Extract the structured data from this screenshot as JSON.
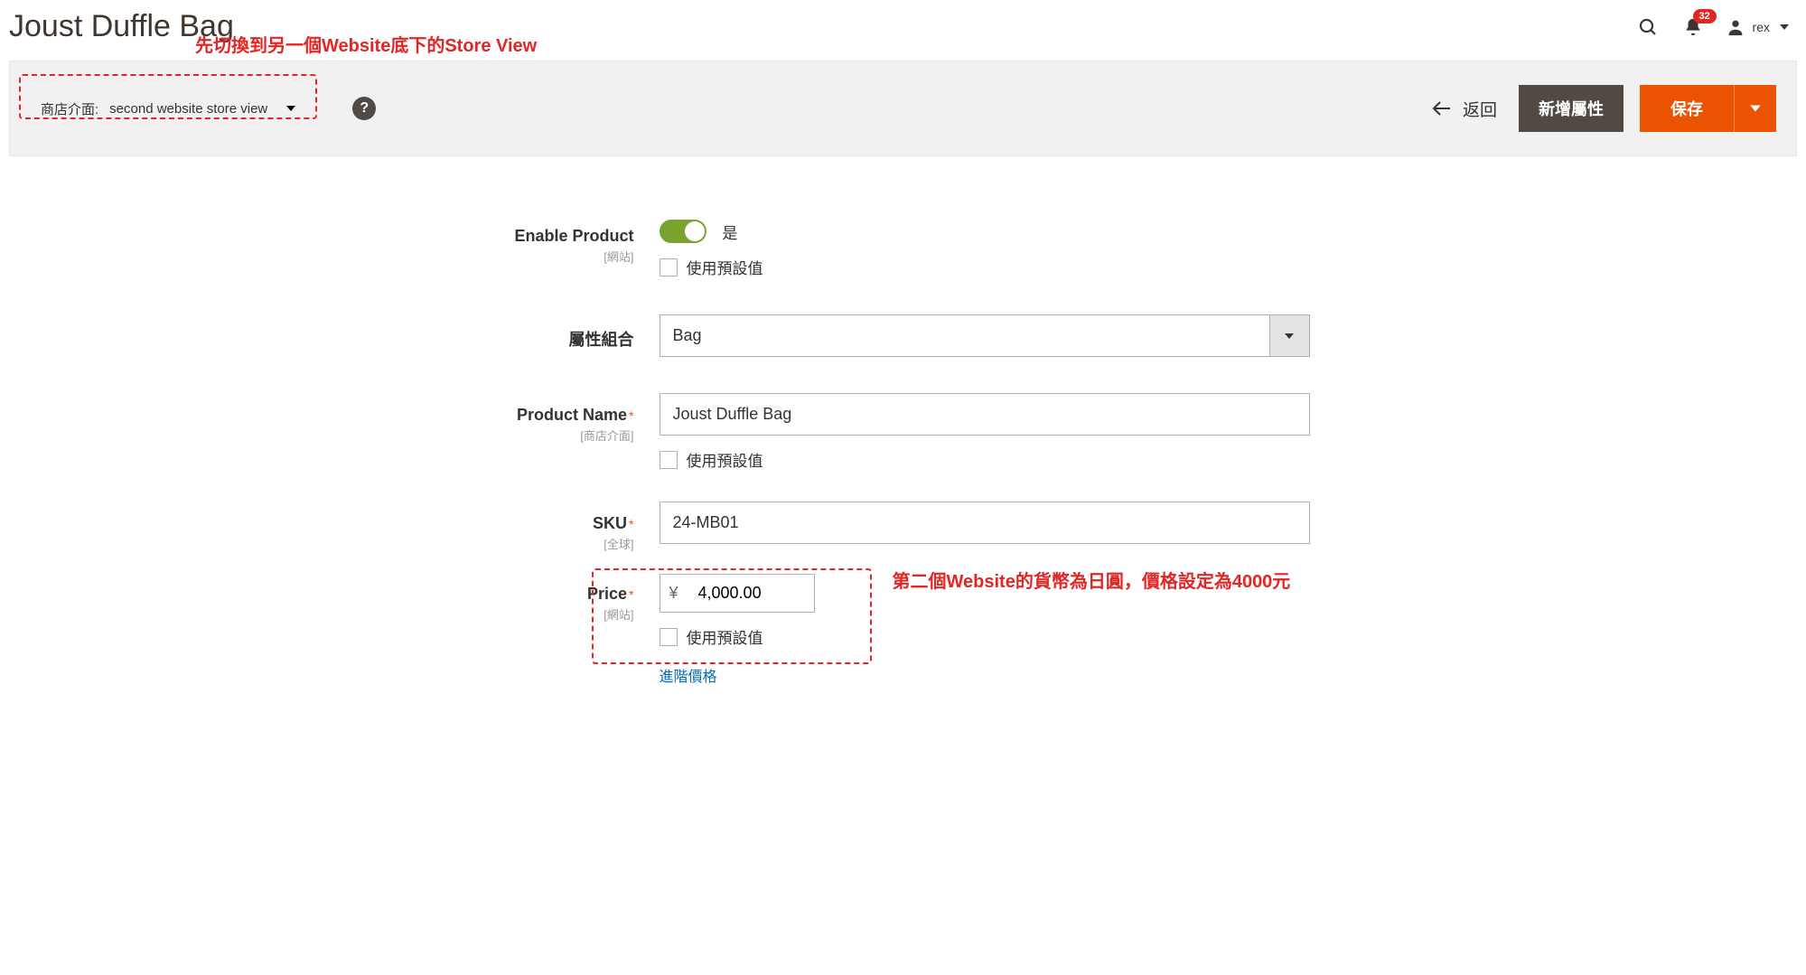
{
  "header": {
    "title": "Joust Duffle Bag",
    "notif_count": "32",
    "username": "rex"
  },
  "action_bar": {
    "store_label": "商店介面:",
    "store_value": "second website store view",
    "back_label": "返回",
    "add_attr_label": "新增屬性",
    "save_label": "保存"
  },
  "annotations": {
    "top": "先切換到另一個Website底下的Store View",
    "price": "第二個Website的貨幣為日圓，價格設定為4000元"
  },
  "fields": {
    "enable_product": {
      "label": "Enable Product",
      "scope": "[網站]",
      "value_text": "是",
      "use_default": "使用預設值"
    },
    "attribute_set": {
      "label": "屬性組合",
      "value": "Bag"
    },
    "product_name": {
      "label": "Product Name",
      "scope": "[商店介面]",
      "value": "Joust Duffle Bag",
      "use_default": "使用預設值"
    },
    "sku": {
      "label": "SKU",
      "scope": "[全球]",
      "value": "24-MB01"
    },
    "price": {
      "label": "Price",
      "scope": "[網站]",
      "currency": "¥",
      "value": "4,000.00",
      "use_default": "使用預設值",
      "advanced_link": "進階價格"
    }
  }
}
